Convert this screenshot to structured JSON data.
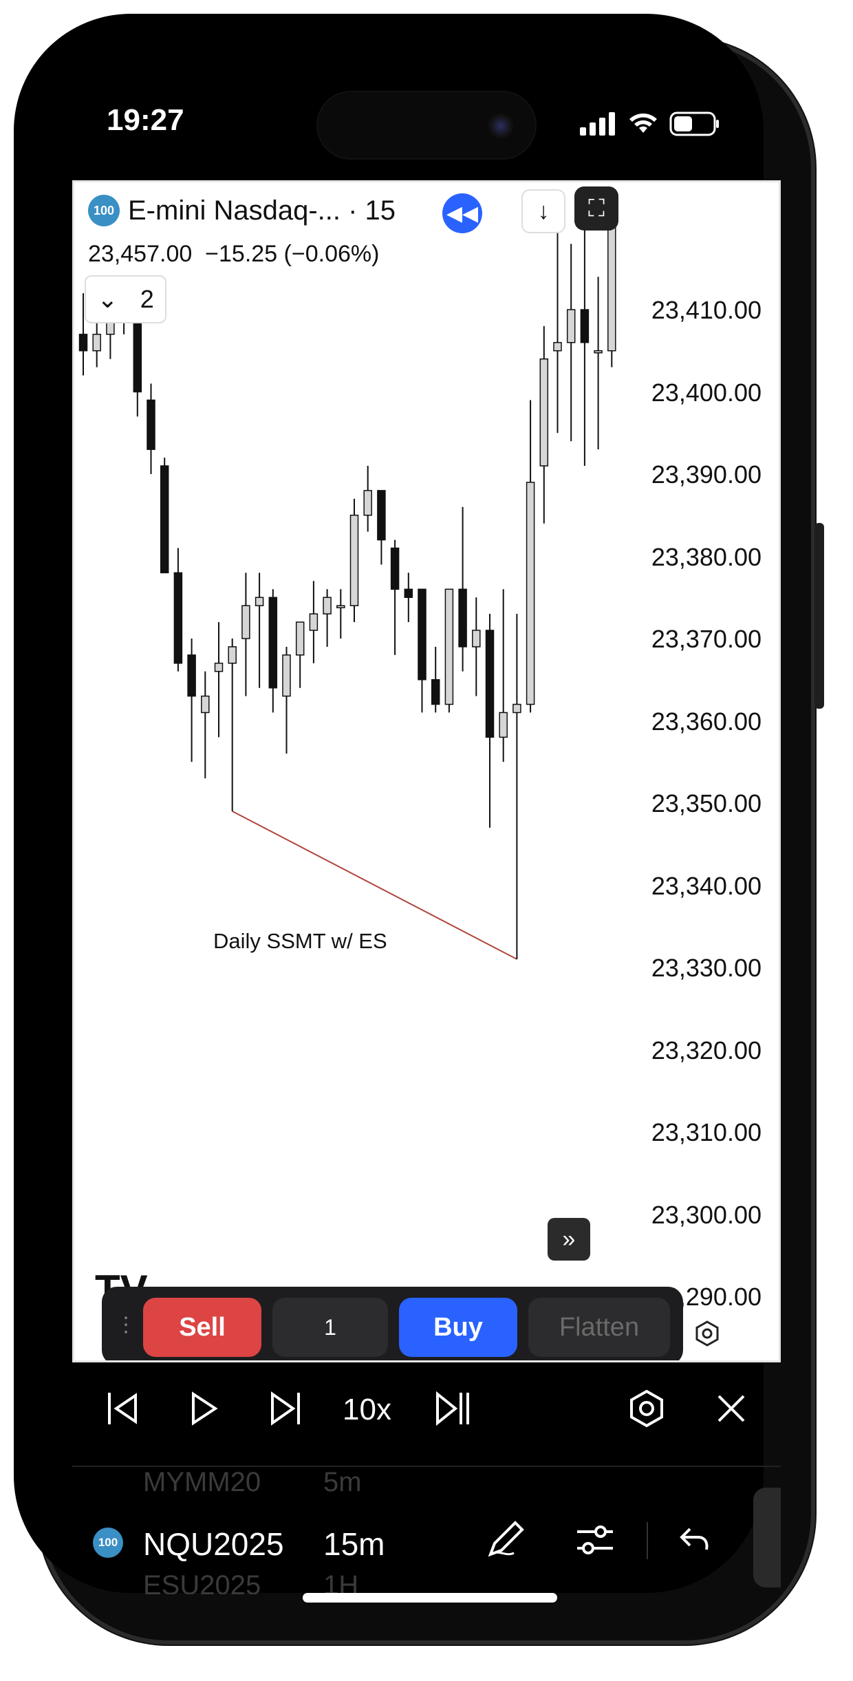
{
  "status_bar": {
    "time": "19:27"
  },
  "header": {
    "symbol_badge": "100",
    "symbol_title": "E-mini Nasdaq-... · 15",
    "last_price": "23,457.00",
    "change": "−15.25 (−0.06%)",
    "indicator_count": "2",
    "icons": [
      "replay-rewind-icon",
      "arrow-down-icon",
      "fullscreen-icon"
    ]
  },
  "chart_data": {
    "type": "candlestick",
    "y_axis_labels": [
      "23,410.00",
      "23,400.00",
      "23,390.00",
      "23,380.00",
      "23,370.00",
      "23,360.00",
      "23,350.00",
      "23,340.00",
      "23,330.00",
      "23,320.00",
      "23,310.00",
      "23,300.00",
      "23,290.00"
    ],
    "ylim": [
      23286,
      23420
    ],
    "candles": [
      {
        "o": 23407,
        "h": 23412,
        "l": 23402,
        "c": 23405
      },
      {
        "o": 23405,
        "h": 23409,
        "l": 23403,
        "c": 23407
      },
      {
        "o": 23407,
        "h": 23413,
        "l": 23404,
        "c": 23410
      },
      {
        "o": 23410,
        "h": 23413,
        "l": 23407,
        "c": 23409
      },
      {
        "o": 23410,
        "h": 23412,
        "l": 23397,
        "c": 23400
      },
      {
        "o": 23399,
        "h": 23401,
        "l": 23390,
        "c": 23393
      },
      {
        "o": 23391,
        "h": 23392,
        "l": 23378,
        "c": 23378
      },
      {
        "o": 23378,
        "h": 23381,
        "l": 23366,
        "c": 23367
      },
      {
        "o": 23368,
        "h": 23370,
        "l": 23355,
        "c": 23363
      },
      {
        "o": 23361,
        "h": 23366,
        "l": 23353,
        "c": 23363
      },
      {
        "o": 23366,
        "h": 23372,
        "l": 23358,
        "c": 23367
      },
      {
        "o": 23367,
        "h": 23370,
        "l": 23349,
        "c": 23369
      },
      {
        "o": 23370,
        "h": 23378,
        "l": 23363,
        "c": 23374
      },
      {
        "o": 23374,
        "h": 23378,
        "l": 23364,
        "c": 23375
      },
      {
        "o": 23375,
        "h": 23376,
        "l": 23361,
        "c": 23364
      },
      {
        "o": 23363,
        "h": 23369,
        "l": 23356,
        "c": 23368
      },
      {
        "o": 23368,
        "h": 23372,
        "l": 23364,
        "c": 23372
      },
      {
        "o": 23371,
        "h": 23377,
        "l": 23367,
        "c": 23373
      },
      {
        "o": 23373,
        "h": 23376,
        "l": 23369,
        "c": 23375
      },
      {
        "o": 23374,
        "h": 23376,
        "l": 23370,
        "c": 23374
      },
      {
        "o": 23374,
        "h": 23387,
        "l": 23372,
        "c": 23385
      },
      {
        "o": 23385,
        "h": 23391,
        "l": 23383,
        "c": 23388
      },
      {
        "o": 23388,
        "h": 23388,
        "l": 23379,
        "c": 23382
      },
      {
        "o": 23381,
        "h": 23382,
        "l": 23368,
        "c": 23376
      },
      {
        "o": 23376,
        "h": 23378,
        "l": 23372,
        "c": 23375
      },
      {
        "o": 23376,
        "h": 23376,
        "l": 23361,
        "c": 23365
      },
      {
        "o": 23365,
        "h": 23369,
        "l": 23361,
        "c": 23362
      },
      {
        "o": 23362,
        "h": 23376,
        "l": 23361,
        "c": 23376
      },
      {
        "o": 23376,
        "h": 23386,
        "l": 23366,
        "c": 23369
      },
      {
        "o": 23369,
        "h": 23375,
        "l": 23363,
        "c": 23371
      },
      {
        "o": 23371,
        "h": 23373,
        "l": 23347,
        "c": 23358
      },
      {
        "o": 23358,
        "h": 23376,
        "l": 23355,
        "c": 23361
      },
      {
        "o": 23361,
        "h": 23373,
        "l": 23331,
        "c": 23362
      },
      {
        "o": 23362,
        "h": 23399,
        "l": 23361,
        "c": 23389
      },
      {
        "o": 23391,
        "h": 23408,
        "l": 23384,
        "c": 23404
      },
      {
        "o": 23405,
        "h": 23424,
        "l": 23395,
        "c": 23406
      },
      {
        "o": 23406,
        "h": 23418,
        "l": 23394,
        "c": 23410
      },
      {
        "o": 23410,
        "h": 23420,
        "l": 23391,
        "c": 23406
      },
      {
        "o": 23405,
        "h": 23414,
        "l": 23393,
        "c": 23405
      },
      {
        "o": 23405,
        "h": 23424,
        "l": 23403,
        "c": 23424
      }
    ],
    "annotation": {
      "text": "Daily SSMT w/ ES",
      "from": {
        "index": 11,
        "price": 23349
      },
      "to": {
        "index": 32,
        "price": 23331
      }
    },
    "colors": {
      "up_fill": "#d6d6d6",
      "down_fill": "#111111",
      "wick": "#111111",
      "trend_line": "#b0443c"
    }
  },
  "order_panel": {
    "sell_label": "Sell",
    "quantity": "1",
    "buy_label": "Buy",
    "flatten_label": "Flatten",
    "colors": {
      "sell": "#dd4444",
      "buy": "#2962ff",
      "qty_bg": "#2c2c2e",
      "flatten_bg": "#2c2c2e"
    }
  },
  "replay_bar": {
    "speed_label": "10x",
    "icons": [
      "jump-to-start-icon",
      "play-icon",
      "step-forward-icon",
      "jump-to-realtime-icon",
      "settings-icon",
      "close-icon"
    ]
  },
  "bottom_bar": {
    "symbol_badge": "100",
    "symbol": "NQU2025",
    "interval": "15m",
    "ghost_above_symbol": "MYMM20",
    "ghost_above_interval": "5m",
    "ghost_below_symbol": "ESU2025",
    "ghost_below_interval": "1H",
    "icons": [
      "pen-icon",
      "sliders-icon",
      "undo-icon"
    ]
  }
}
